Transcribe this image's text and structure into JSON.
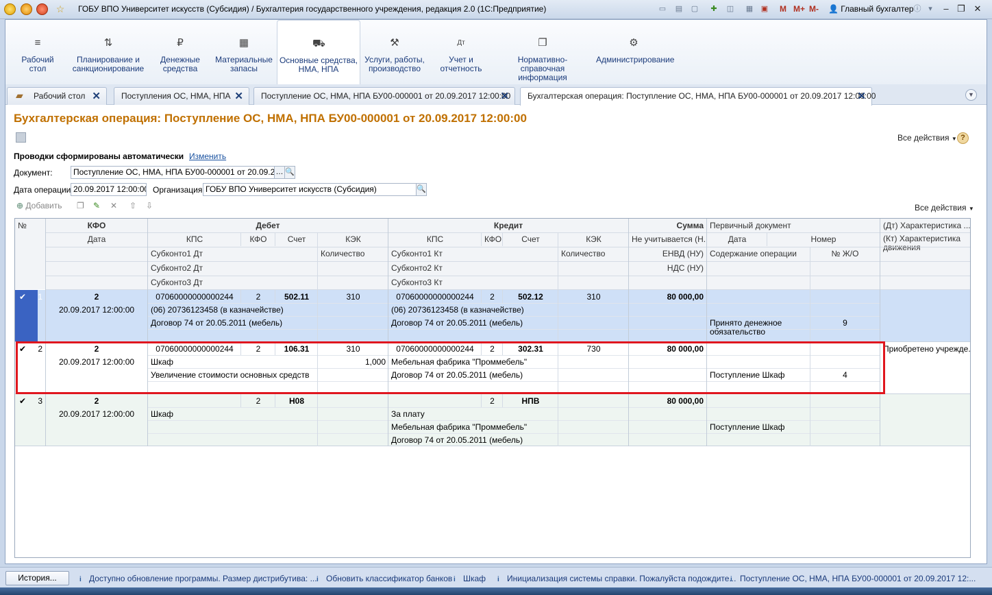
{
  "window": {
    "title": "ГОБУ ВПО Университет искусств (Субсидия) / Бухгалтерия государственного учреждения, редакция 2.0  (1С:Предприятие)",
    "user": "Главный бухгалтер",
    "m1": "M",
    "m2": "M+",
    "m3": "M-"
  },
  "sections": [
    {
      "label": "Рабочий\nстол",
      "icon": "menu-icon"
    },
    {
      "label": "Планирование и\nсанкционирование",
      "icon": "planning-icon"
    },
    {
      "label": "Денежные\nсредства",
      "icon": "ruble-icon"
    },
    {
      "label": "Материальные\nзапасы",
      "icon": "grid-icon"
    },
    {
      "label": "Основные средства,\nНМА, НПА",
      "icon": "truck-icon"
    },
    {
      "label": "Услуги, работы,\nпроизводство",
      "icon": "tools-icon"
    },
    {
      "label": "Учет и\nотчетность",
      "icon": "dtkt-icon"
    },
    {
      "label": "Нормативно-справочная\nинформация",
      "icon": "books-icon"
    },
    {
      "label": "Администрирование",
      "icon": "gear-icon"
    }
  ],
  "tabs": [
    {
      "label": "Рабочий стол"
    },
    {
      "label": "Поступления ОС, НМА, НПА"
    },
    {
      "label": "Поступление ОС, НМА, НПА БУ00-000001 от 20.09.2017 12:00:00"
    },
    {
      "label": "Бухгалтерская операция: Поступление ОС, НМА, НПА БУ00-000001 от 20.09.2017 12:00:00"
    }
  ],
  "form": {
    "title": "Бухгалтерская операция: Поступление ОС, НМА, НПА БУ00-000001 от 20.09.2017 12:00:00",
    "all_actions": "Все действия",
    "auto_note": "Проводки сформированы автоматически",
    "change_link": "Изменить",
    "doc_label": "Документ:",
    "doc_value": "Поступление ОС, НМА, НПА БУ00-000001 от 20.09.2017 1",
    "date_label": "Дата операции:",
    "date_value": "20.09.2017 12:00:00",
    "org_label": "Организация:",
    "org_value": "ГОБУ ВПО Университет искусств (Субсидия)"
  },
  "toolbar": {
    "add": "Добавить",
    "all_actions": "Все действия"
  },
  "grid_header": {
    "num": "№",
    "kfo": "КФО",
    "date": "Дата",
    "debit": "Дебет",
    "credit": "Кредит",
    "sum": "Сумма",
    "primary": "Первичный документ",
    "char_dt": "(Дт) Характеристика ...",
    "kps": "КПС",
    "kfo2": "КФО",
    "schet": "Счет",
    "kek": "КЭК",
    "sub1dt": "Субконто1 Дт",
    "sub2dt": "Субконто2 Дт",
    "sub3dt": "Субконто3 Дт",
    "qty": "Количество",
    "sub1kt": "Субконто1 Кт",
    "sub2kt": "Субконто2 Кт",
    "sub3kt": "Субконто3 Кт",
    "not_counted": "Не учитывается (Н...",
    "envd": "ЕНВД (НУ)",
    "nds": "НДС (НУ)",
    "pdate": "Дата",
    "pnum": "Номер",
    "content": "Содержание операции",
    "jo": "№ Ж/О",
    "char_kt": "(Кт) Характеристика движения"
  },
  "rows": [
    {
      "n": "1",
      "check": "✔",
      "kfo": "2",
      "date": "20.09.2017 12:00:00",
      "dt_kps": "07060000000000244",
      "dt_kfo": "2",
      "dt_schet": "502.11",
      "dt_kek": "310",
      "dt_s1": "(06) 20736123458 (в казначействе)",
      "dt_s2": "Договор 74 от 20.05.2011 (мебель)",
      "dt_s3": "",
      "dt_qty": "",
      "kt_kps": "07060000000000244",
      "kt_kfo": "2",
      "kt_schet": "502.12",
      "kt_kek": "310",
      "kt_s1": "(06) 20736123458 (в казначействе)",
      "kt_s2": "Договор 74 от 20.05.2011 (мебель)",
      "kt_s3": "",
      "kt_qty": "",
      "sum": "80 000,00",
      "content": "Принято денежное обязательство",
      "jo": "9",
      "char": ""
    },
    {
      "n": "2",
      "check": "✔",
      "kfo": "2",
      "date": "20.09.2017 12:00:00",
      "dt_kps": "07060000000000244",
      "dt_kfo": "2",
      "dt_schet": "106.31",
      "dt_kek": "310",
      "dt_s1": "Шкаф",
      "dt_s2": "Увеличение стоимости основных средств",
      "dt_s3": "",
      "dt_qty": "1,000",
      "kt_kps": "07060000000000244",
      "kt_kfo": "2",
      "kt_schet": "302.31",
      "kt_kek": "730",
      "kt_s1": "Мебельная фабрика \"Проммебель\"",
      "kt_s2": "Договор 74 от 20.05.2011 (мебель)",
      "kt_s3": "",
      "kt_qty": "",
      "sum": "80 000,00",
      "content": "Поступление Шкаф",
      "jo": "4",
      "char": "Приобретено учрежде..."
    },
    {
      "n": "3",
      "check": "✔",
      "kfo": "2",
      "date": "20.09.2017 12:00:00",
      "dt_kps": "",
      "dt_kfo": "2",
      "dt_schet": "Н08",
      "dt_kek": "",
      "dt_s1": "Шкаф",
      "dt_s2": "",
      "dt_s3": "",
      "dt_qty": "",
      "kt_kps": "",
      "kt_kfo": "2",
      "kt_schet": "НПВ",
      "kt_kek": "",
      "kt_s1": "За плату",
      "kt_s2": "Мебельная фабрика \"Проммебель\"",
      "kt_s3": "Договор 74 от 20.05.2011 (мебель)",
      "kt_qty": "",
      "sum": "80 000,00",
      "content": "Поступление Шкаф",
      "jo": "",
      "char": ""
    }
  ],
  "statusbar": {
    "history": "История...",
    "items": [
      "Доступно обновление программы. Размер дистрибутива: ...",
      "Обновить классификатор банков",
      "Шкаф",
      "Инициализация системы справки. Пожалуйста подождите...",
      "Поступление ОС, НМА, НПА БУ00-000001 от 20.09.2017 12:..."
    ]
  },
  "colors": {
    "accent": "#c07000",
    "selected_row": "#cfe0f7",
    "highlight": "#e0161e",
    "row_alt": "#eef5f1"
  }
}
